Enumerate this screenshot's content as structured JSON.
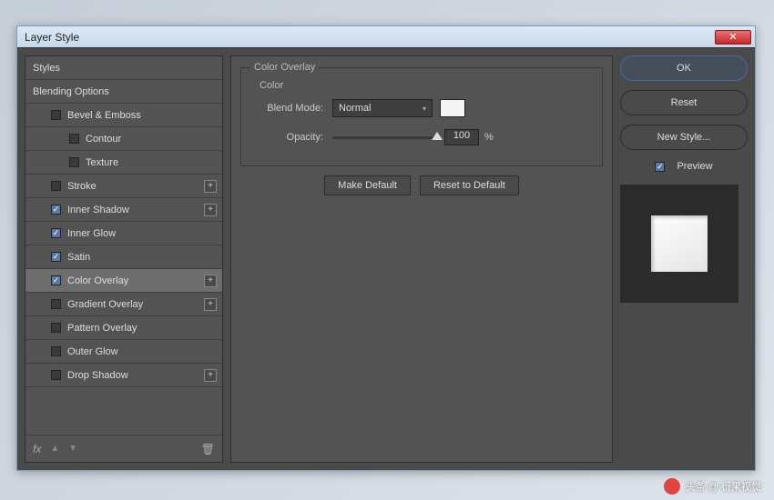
{
  "titlebar": {
    "title": "Layer Style",
    "close": "✕"
  },
  "sidebar": {
    "styles": "Styles",
    "blending": "Blending Options",
    "items": [
      {
        "label": "Bevel & Emboss",
        "checked": false,
        "hasPlus": false
      },
      {
        "label": "Contour",
        "checked": false,
        "sub": true
      },
      {
        "label": "Texture",
        "checked": false,
        "sub": true
      },
      {
        "label": "Stroke",
        "checked": false,
        "hasPlus": true
      },
      {
        "label": "Inner Shadow",
        "checked": true,
        "hasPlus": true
      },
      {
        "label": "Inner Glow",
        "checked": true
      },
      {
        "label": "Satin",
        "checked": true
      },
      {
        "label": "Color Overlay",
        "checked": true,
        "hasPlus": true,
        "selected": true
      },
      {
        "label": "Gradient Overlay",
        "checked": false,
        "hasPlus": true
      },
      {
        "label": "Pattern Overlay",
        "checked": false
      },
      {
        "label": "Outer Glow",
        "checked": false
      },
      {
        "label": "Drop Shadow",
        "checked": false,
        "hasPlus": true
      }
    ],
    "fx": "fx"
  },
  "center": {
    "group": "Color Overlay",
    "sub": "Color",
    "blendModeLabel": "Blend Mode:",
    "blendModeValue": "Normal",
    "opacityLabel": "Opacity:",
    "opacityValue": "100",
    "opacityUnit": "%",
    "makeDefault": "Make Default",
    "resetDefault": "Reset to Default",
    "swatch": "#f5f5f5"
  },
  "right": {
    "ok": "OK",
    "reset": "Reset",
    "newStyle": "New Style...",
    "preview": "Preview",
    "previewChecked": true
  },
  "watermark": "头条 @ 衍果视觉"
}
